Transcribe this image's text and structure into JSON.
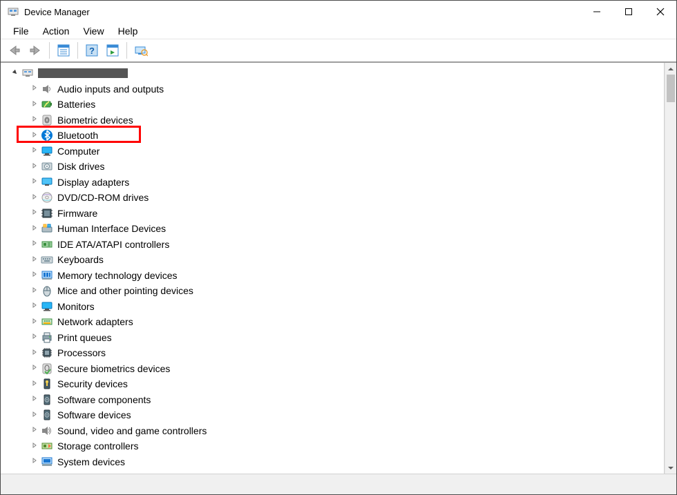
{
  "window": {
    "title": "Device Manager"
  },
  "menubar": {
    "items": [
      "File",
      "Action",
      "View",
      "Help"
    ]
  },
  "tree": {
    "root": {
      "expanded": true,
      "label_redacted": true
    },
    "categories": [
      {
        "icon": "speaker-icon",
        "label": "Audio inputs and outputs"
      },
      {
        "icon": "battery-icon",
        "label": "Batteries"
      },
      {
        "icon": "fingerprint-icon",
        "label": "Biometric devices"
      },
      {
        "icon": "bluetooth-icon",
        "label": "Bluetooth",
        "highlighted": true
      },
      {
        "icon": "monitor-icon",
        "label": "Computer"
      },
      {
        "icon": "disk-icon",
        "label": "Disk drives"
      },
      {
        "icon": "display-icon",
        "label": "Display adapters"
      },
      {
        "icon": "dvd-icon",
        "label": "DVD/CD-ROM drives"
      },
      {
        "icon": "firmware-icon",
        "label": "Firmware"
      },
      {
        "icon": "hid-icon",
        "label": "Human Interface Devices"
      },
      {
        "icon": "ide-icon",
        "label": "IDE ATA/ATAPI controllers"
      },
      {
        "icon": "keyboard-icon",
        "label": "Keyboards"
      },
      {
        "icon": "memory-icon",
        "label": "Memory technology devices"
      },
      {
        "icon": "mouse-icon",
        "label": "Mice and other pointing devices"
      },
      {
        "icon": "monitor-icon",
        "label": "Monitors"
      },
      {
        "icon": "network-icon",
        "label": "Network adapters"
      },
      {
        "icon": "printer-icon",
        "label": "Print queues"
      },
      {
        "icon": "cpu-icon",
        "label": "Processors"
      },
      {
        "icon": "secure-bio-icon",
        "label": "Secure biometrics devices"
      },
      {
        "icon": "security-icon",
        "label": "Security devices"
      },
      {
        "icon": "software-icon",
        "label": "Software components"
      },
      {
        "icon": "software-icon",
        "label": "Software devices"
      },
      {
        "icon": "sound-icon",
        "label": "Sound, video and game controllers"
      },
      {
        "icon": "storage-icon",
        "label": "Storage controllers"
      },
      {
        "icon": "system-icon",
        "label": "System devices"
      }
    ]
  },
  "colors": {
    "highlight": "#ff0000",
    "bluetooth": "#0078d7"
  }
}
